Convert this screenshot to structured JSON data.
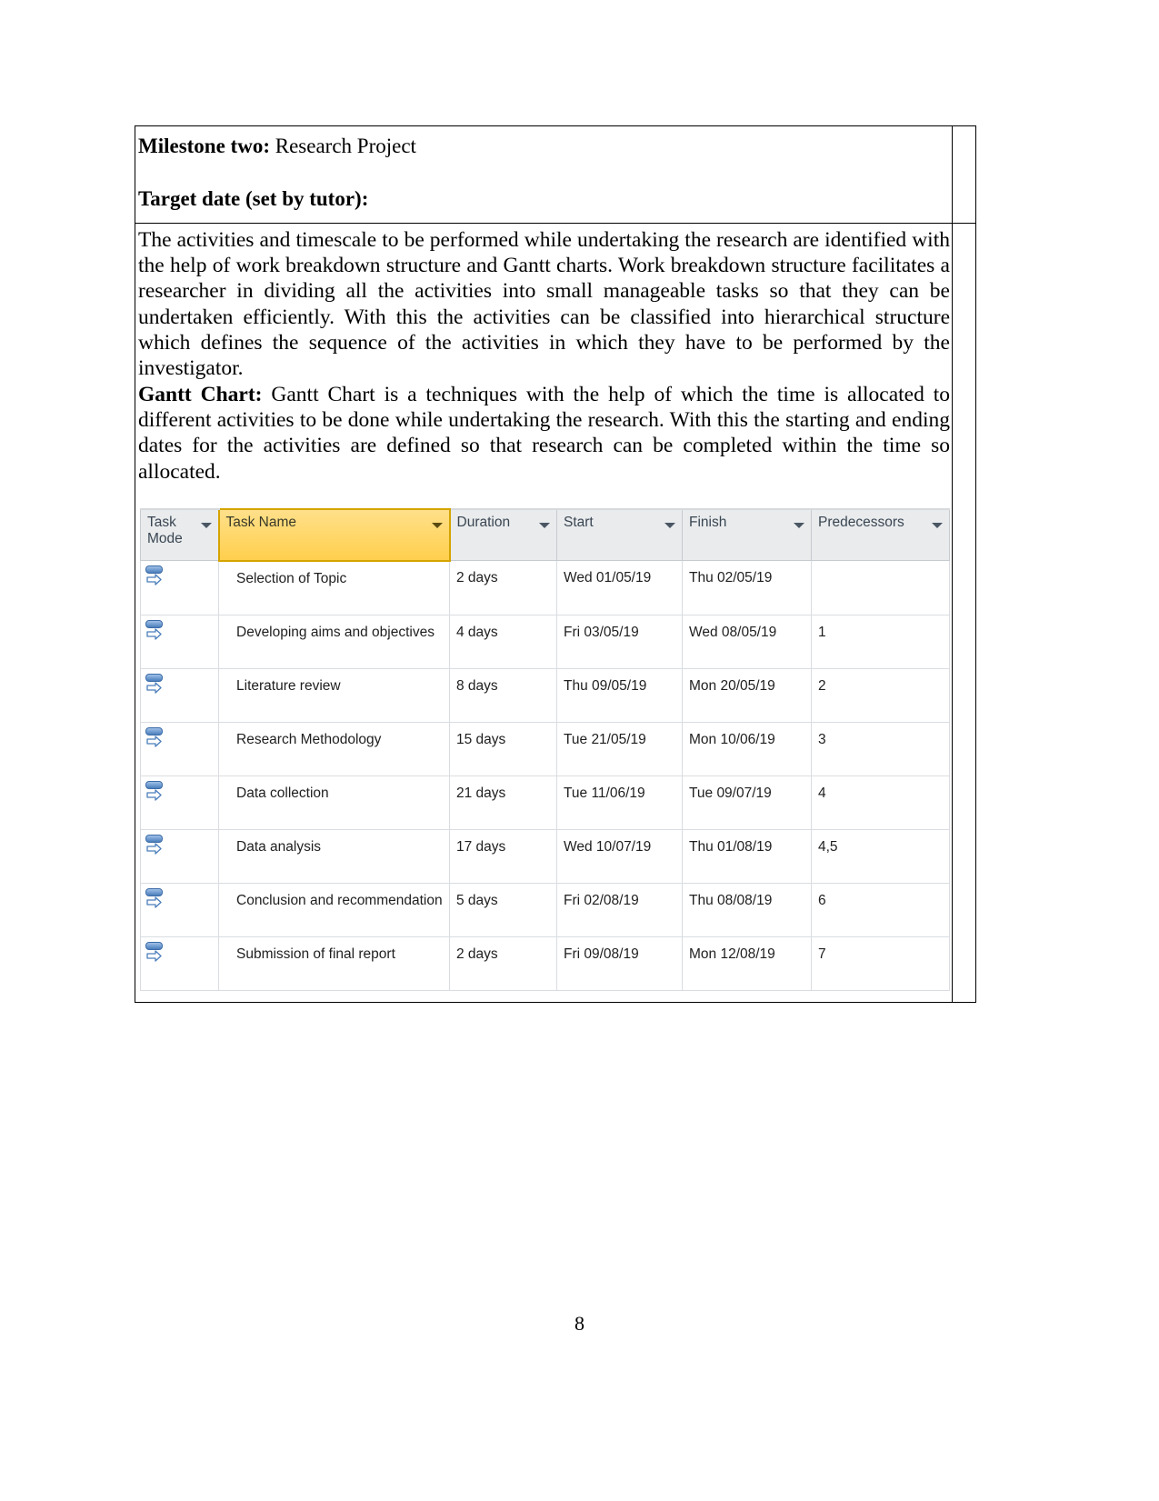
{
  "document": {
    "milestone": {
      "label": "Milestone two:",
      "value": " Research Project",
      "target_date_label": "Target date (set by tutor):"
    },
    "paragraphs": [
      {
        "heading": "",
        "text": "The activities and timescale to be performed while undertaking the research are identified with the help of work breakdown structure and Gantt charts. Work breakdown structure facilitates a researcher in dividing all the activities into small manageable tasks so that they can be undertaken efficiently. With this the activities can be classified into hierarchical structure which defines the sequence of the activities in which they have to be performed by the investigator."
      },
      {
        "heading": "Gantt Chart:",
        "text": " Gantt Chart is a techniques with the help of which the time is allocated to different activities to be done while undertaking the research. With this the starting and ending dates for the activities are defined so that research can be completed within the time so allocated."
      }
    ],
    "page_number": "8"
  },
  "gantt_table": {
    "columns": [
      {
        "label": "Task Mode",
        "icon": "chevron-down-icon",
        "highlighted": false
      },
      {
        "label": "Task Name",
        "icon": "chevron-down-icon",
        "highlighted": true
      },
      {
        "label": "Duration",
        "icon": "chevron-down-icon",
        "highlighted": false
      },
      {
        "label": "Start",
        "icon": "chevron-down-icon",
        "highlighted": false
      },
      {
        "label": "Finish",
        "icon": "chevron-down-icon",
        "highlighted": false
      },
      {
        "label": "Predecessors",
        "icon": "chevron-down-icon",
        "highlighted": false
      }
    ],
    "header_highlight_color": "#ffd966",
    "header_background_color": "#e9ebed",
    "task_mode_icon": "auto-scheduled-icon",
    "rows": [
      {
        "mode": "auto-scheduled-icon",
        "name": "Selection of Topic",
        "duration": "2 days",
        "start": "Wed 01/05/19",
        "finish": "Thu 02/05/19",
        "predecessors": ""
      },
      {
        "mode": "auto-scheduled-icon",
        "name": "Developing aims and objectives",
        "duration": "4 days",
        "start": "Fri 03/05/19",
        "finish": "Wed 08/05/19",
        "predecessors": "1"
      },
      {
        "mode": "auto-scheduled-icon",
        "name": "Literature review",
        "duration": "8 days",
        "start": "Thu 09/05/19",
        "finish": "Mon 20/05/19",
        "predecessors": "2"
      },
      {
        "mode": "auto-scheduled-icon",
        "name": "Research Methodology",
        "duration": "15 days",
        "start": "Tue 21/05/19",
        "finish": "Mon 10/06/19",
        "predecessors": "3"
      },
      {
        "mode": "auto-scheduled-icon",
        "name": "Data collection",
        "duration": "21 days",
        "start": "Tue 11/06/19",
        "finish": "Tue 09/07/19",
        "predecessors": "4"
      },
      {
        "mode": "auto-scheduled-icon",
        "name": "Data analysis",
        "duration": "17 days",
        "start": "Wed 10/07/19",
        "finish": "Thu 01/08/19",
        "predecessors": "4,5"
      },
      {
        "mode": "auto-scheduled-icon",
        "name": "Conclusion and recommendation",
        "duration": "5 days",
        "start": "Fri 02/08/19",
        "finish": "Thu 08/08/19",
        "predecessors": "6"
      },
      {
        "mode": "auto-scheduled-icon",
        "name": "Submission of final report",
        "duration": "2 days",
        "start": "Fri 09/08/19",
        "finish": "Mon 12/08/19",
        "predecessors": "7"
      }
    ]
  }
}
